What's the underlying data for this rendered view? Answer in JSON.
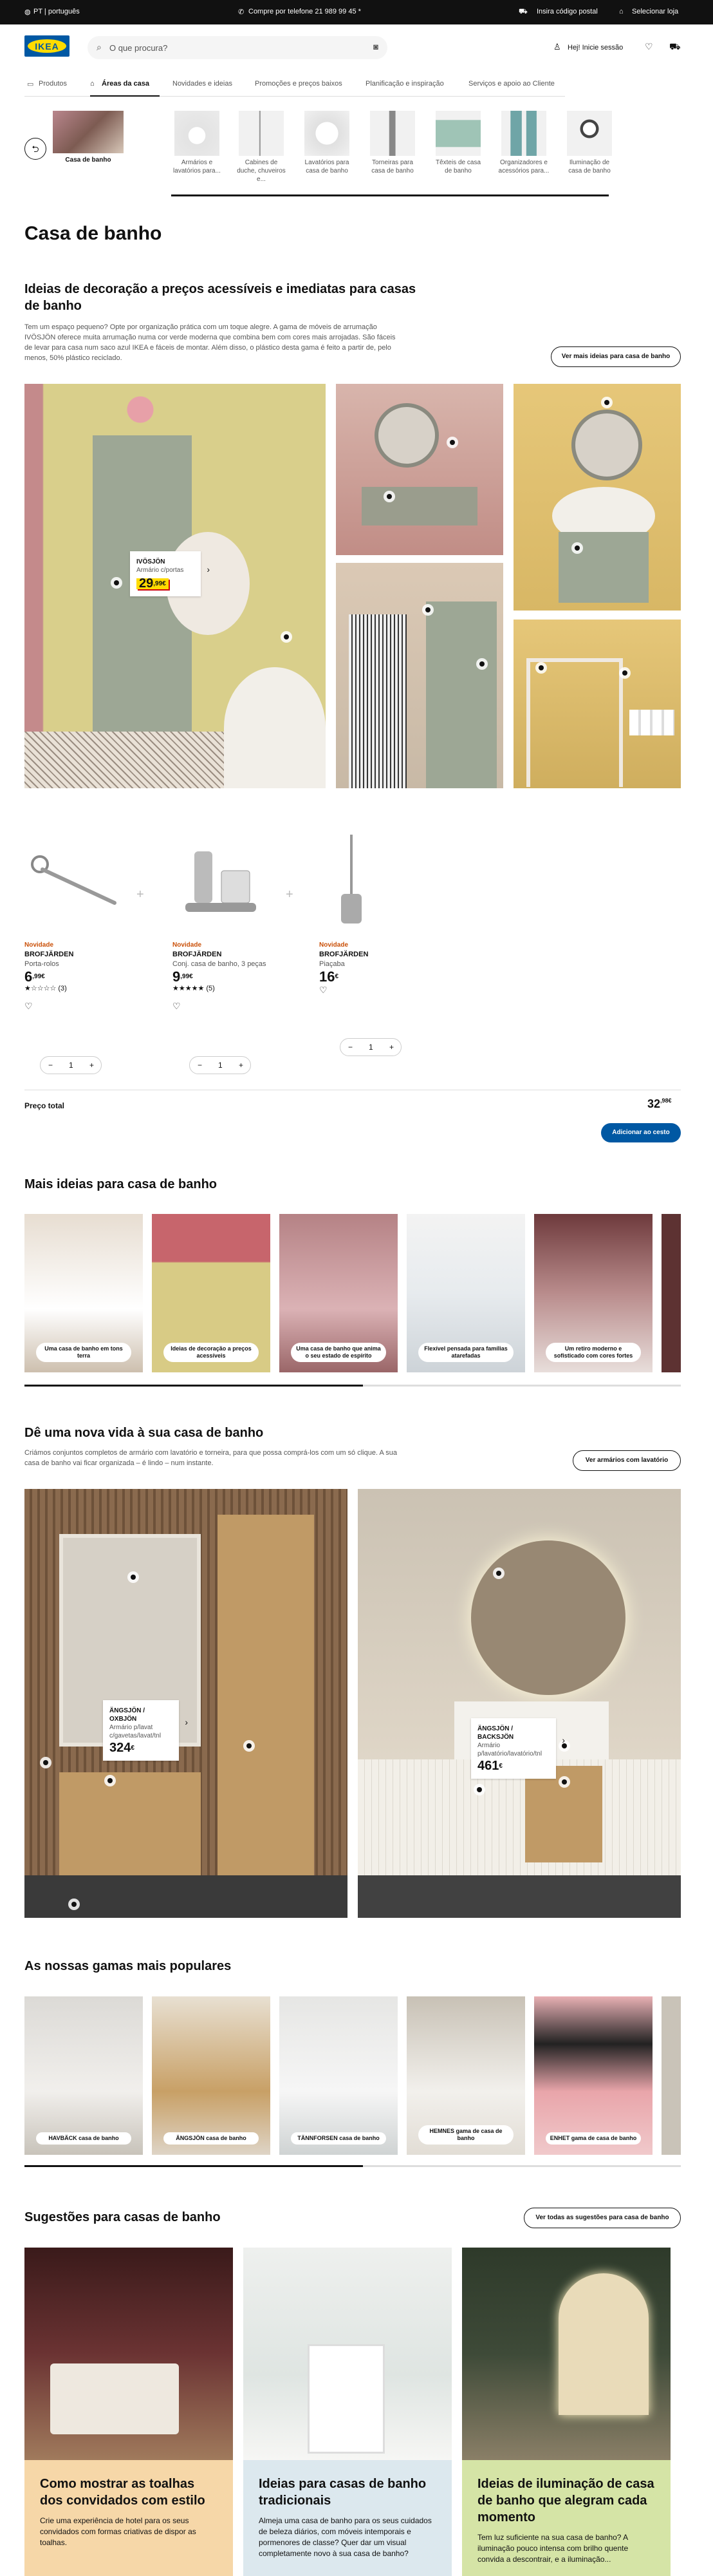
{
  "topbar": {
    "locale": "PT | português",
    "phone": "Compre por telefone 21 989 99 45 *",
    "postal": "Insira código postal",
    "store": "Selecionar loja"
  },
  "header": {
    "logo": "IKEA",
    "search_placeholder": "O que procura?",
    "login": "Hej! Inicie sessão"
  },
  "nav": {
    "items": [
      "Produtos",
      "Áreas da casa",
      "Novidades e ideias",
      "Promoções e preços baixos",
      "Planificação e inspiração",
      "Serviços e apoio ao Cliente"
    ]
  },
  "categories": [
    {
      "label": "Casa de banho"
    },
    {
      "label": "Armários e lavatórios para..."
    },
    {
      "label": "Cabines de duche, chuveiros e..."
    },
    {
      "label": "Lavatórios para casa de banho"
    },
    {
      "label": "Torneiras para casa de banho"
    },
    {
      "label": "Têxteis de casa de banho"
    },
    {
      "label": "Organizadores e acessórios para..."
    },
    {
      "label": "Iluminação de casa de banho"
    }
  ],
  "page_title": "Casa de banho",
  "ideas": {
    "title": "Ideias de decoração a preços acessíveis e imediatas para casas de banho",
    "text": "Tem um espaço pequeno? Opte por organização prática com um toque alegre. A gama de móveis de arrumação IVÖSJÖN oferece muita arrumação numa cor verde moderna que combina bem com cores mais arrojadas. São fáceis de levar para casa num saco azul IKEA e fáceis de montar. Além disso, o plástico desta gama é feito a partir de, pelo menos, 50% plástico reciclado.",
    "button": "Ver mais ideias para casa de banho",
    "tag": {
      "name": "IVÖSJÖN",
      "desc": "Armário c/portas",
      "price": "29",
      "cents": ",99€"
    }
  },
  "products": [
    {
      "badge": "Novidade",
      "name": "BROFJÄRDEN",
      "desc": "Porta-rolos",
      "price": "6",
      "cents": ",99€",
      "rating": "(3)",
      "qty": "1"
    },
    {
      "badge": "Novidade",
      "name": "BROFJÄRDEN",
      "desc": "Conj. casa de banho, 3 peças",
      "price": "9",
      "cents": ",99€",
      "rating": "(5)",
      "qty": "1"
    },
    {
      "badge": "Novidade",
      "name": "BROFJÄRDEN",
      "desc": "Piaçaba",
      "price": "16",
      "cents": "€",
      "rating": "",
      "qty": "1"
    }
  ],
  "total": {
    "label": "Preço total",
    "price": "32",
    "cents": ",98€",
    "button": "Adicionar ao cesto"
  },
  "more_ideas": {
    "title": "Mais ideias para casa de banho",
    "cards": [
      "Uma casa de banho em tons terra",
      "Ideias de decoração a preços acessíveis",
      "Uma casa de banho que anima o seu estado de espírito",
      "Flexível pensada para famílias atarefadas",
      "Um retiro moderno e sofisticado com cores fortes"
    ]
  },
  "new_life": {
    "title": "Dê uma nova vida à sua casa de banho",
    "text": "Criámos conjuntos completos de armário com lavatório e torneira, para que possa comprá-los com um só clique. A sua casa de banho vai ficar organizada – é lindo – num instante.",
    "button": "Ver armários com lavatório",
    "tag1": {
      "name": "ÄNGSJÖN / OXBJÖN",
      "desc": "Armário p/lavat c/gavetas/lavat/tnl",
      "price": "324",
      "cents": "€"
    },
    "tag2": {
      "name": "ÄNGSJÖN / BACKSJÖN",
      "desc": "Armário p/lavatório/lavatório/tnl",
      "price": "461",
      "cents": "€"
    }
  },
  "popular": {
    "title": "As nossas gamas mais populares",
    "cards": [
      "HAVBÄCK casa de banho",
      "ÄNGSJÖN casa de banho",
      "TÄNNFORSEN casa de banho",
      "HEMNES gama de casa de banho",
      "ENHET gama de casa de banho"
    ]
  },
  "suggestions": {
    "title": "Sugestões para casas de banho",
    "button": "Ver todas as sugestões para casa de banho",
    "cards": [
      {
        "title": "Como mostrar as toalhas dos convidados com estilo",
        "text": "Crie uma experiência de hotel para os seus convidados com formas criativas de dispor as toalhas.",
        "bg": "#f6d7a8"
      },
      {
        "title": "Ideias para casas de banho tradicionais",
        "text": "Almeja uma casa de banho para os seus cuidados de beleza diários, com móveis intemporais e pormenores de classe? Quer dar um visual completamente novo à sua casa de banho?",
        "bg": "#dce8ee"
      },
      {
        "title": "Ideias de iluminação de casa de banho que alegram cada momento",
        "text": "Tem luz suficiente na sua casa de banho? A iluminação pouco intensa com brilho quente convida a descontrair, e a iluminação...",
        "bg": "#d5e4a6"
      }
    ]
  }
}
